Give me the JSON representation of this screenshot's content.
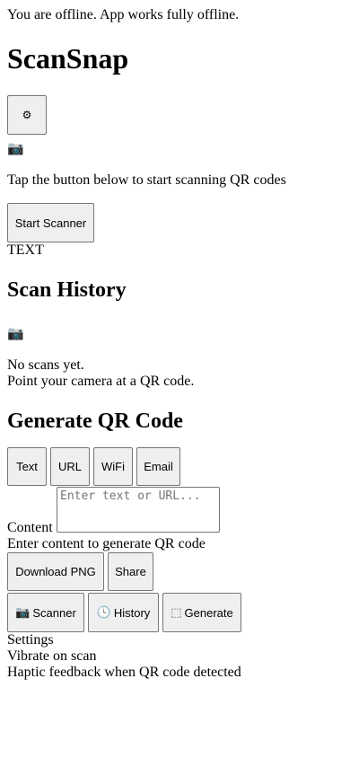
{
  "offline_banner": "You are offline. App works fully offline.",
  "app_title": "ScanSnap",
  "settings_button_icon": "⚙",
  "scanner": {
    "camera_icon": "📷",
    "instruction": "Tap the button below to start scanning QR codes",
    "start_label": "Start Scanner",
    "result_type": "TEXT"
  },
  "history": {
    "heading": "Scan History",
    "empty_icon": "📷",
    "empty_title": "No scans yet.",
    "empty_hint": "Point your camera at a QR code."
  },
  "generate": {
    "heading": "Generate QR Code",
    "types": [
      "Text",
      "URL",
      "WiFi",
      "Email"
    ],
    "content_label": "Content",
    "content_placeholder": "Enter text or URL...",
    "content_value": "",
    "preview_hint": "Enter content to generate QR code",
    "download_label": "Download PNG",
    "share_label": "Share"
  },
  "bottom_nav": {
    "scanner_icon": "📷",
    "scanner_label": "Scanner",
    "history_icon": "🕓",
    "history_label": "History",
    "generate_icon": "⬚",
    "generate_label": "Generate"
  },
  "settings": {
    "heading": "Settings",
    "vibrate_label": "Vibrate on scan",
    "vibrate_desc": "Haptic feedback when QR code detected"
  }
}
